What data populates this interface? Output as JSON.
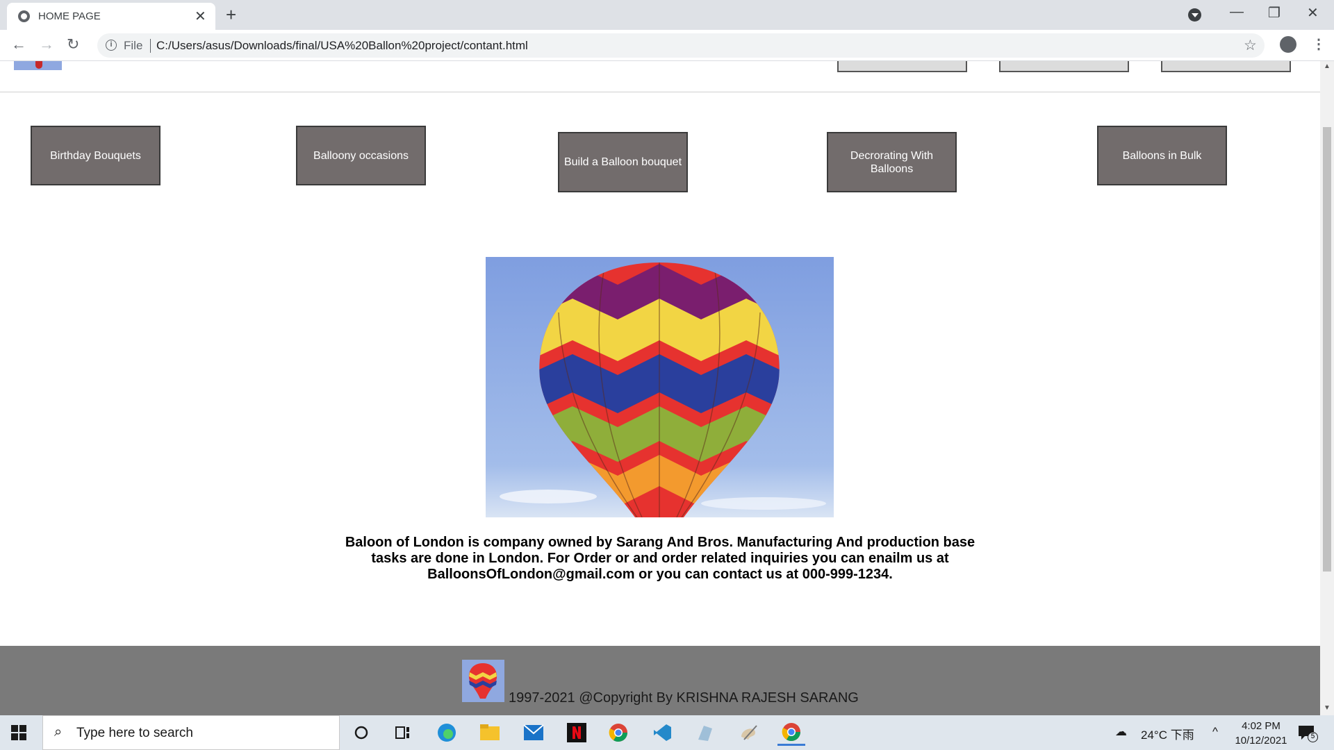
{
  "browser": {
    "tab_title": "HOME PAGE",
    "tab_close": "✕",
    "new_tab": "+",
    "minimize": "—",
    "maximize": "❐",
    "close": "✕",
    "back": "←",
    "forward": "→",
    "reload": "↻",
    "info": "i",
    "file_label": "File",
    "url": "C:/Users/asus/Downloads/final/USA%20Ballon%20project/contant.html",
    "star": "☆",
    "menu": "⋮"
  },
  "page": {
    "categories": [
      {
        "label": "Birthday Bouquets"
      },
      {
        "label": "Balloony occasions"
      },
      {
        "label": "Build a Balloon bouquet"
      },
      {
        "label": "Decrorating With Balloons"
      },
      {
        "label": "Balloons in Bulk"
      }
    ],
    "about_text": "Baloon of London is company owned by Sarang And Bros. Manufacturing And production base tasks are done in London. For Order or and order related inquiries you can enailm us at BalloonsOfLondon@gmail.com or you can contact us at 000-999-1234.",
    "footer_text": "1997-2021 @Copyright By KRISHNA RAJESH SARANG"
  },
  "taskbar": {
    "search_placeholder": "Type here to search",
    "weather": "24°C  下雨",
    "tray_chevron": "^",
    "time": "4:02 PM",
    "date": "10/12/2021",
    "notification_count": "5"
  }
}
